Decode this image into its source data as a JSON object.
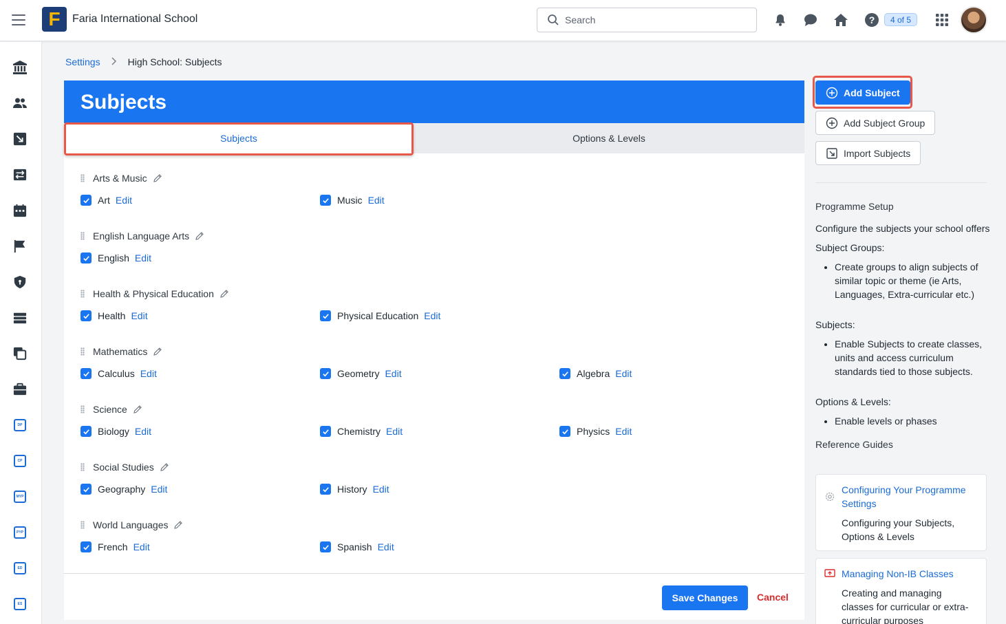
{
  "header": {
    "school_name": "Faria International School",
    "logo_letter": "F",
    "search_placeholder": "Search",
    "page_counter": "4 of 5"
  },
  "breadcrumb": {
    "parent": "Settings",
    "current": "High School: Subjects"
  },
  "card": {
    "title": "Subjects",
    "tabs": [
      "Subjects",
      "Options & Levels"
    ]
  },
  "groups": [
    {
      "name": "Arts & Music",
      "subjects": [
        "Art",
        "Music"
      ]
    },
    {
      "name": "English Language Arts",
      "subjects": [
        "English"
      ]
    },
    {
      "name": "Health & Physical Education",
      "subjects": [
        "Health",
        "Physical Education"
      ]
    },
    {
      "name": "Mathematics",
      "subjects": [
        "Calculus",
        "Geometry",
        "Algebra"
      ]
    },
    {
      "name": "Science",
      "subjects": [
        "Biology",
        "Chemistry",
        "Physics"
      ]
    },
    {
      "name": "Social Studies",
      "subjects": [
        "Geography",
        "History"
      ]
    },
    {
      "name": "World Languages",
      "subjects": [
        "French",
        "Spanish"
      ]
    }
  ],
  "edit_label": "Edit",
  "footer": {
    "save_label": "Save Changes",
    "cancel_label": "Cancel"
  },
  "actions": {
    "add_subject": "Add Subject",
    "add_subject_group": "Add Subject Group",
    "import_subjects": "Import Subjects"
  },
  "help": {
    "title": "Programme Setup",
    "intro": "Configure the subjects your school offers",
    "groups_label": "Subject Groups:",
    "groups_item": "Create groups to align subjects of similar topic or theme (ie Arts, Languages, Extra-curricular etc.)",
    "subjects_label": "Subjects:",
    "subjects_item": "Enable Subjects to create classes, units and access curriculum standards tied to those subjects.",
    "options_label": "Options & Levels:",
    "options_item": "Enable levels or phases",
    "ref_title": "Reference Guides"
  },
  "guides": [
    {
      "title": "Configuring Your Programme Settings",
      "desc": "Configuring your Subjects, Options & Levels"
    },
    {
      "title": "Managing Non-IB Classes",
      "desc": "Creating and managing classes for curricular or extra-curricular purposes"
    }
  ],
  "colors": {
    "primary": "#1a75f0",
    "highlight": "#e8584a",
    "cancel": "#d92c2c"
  }
}
